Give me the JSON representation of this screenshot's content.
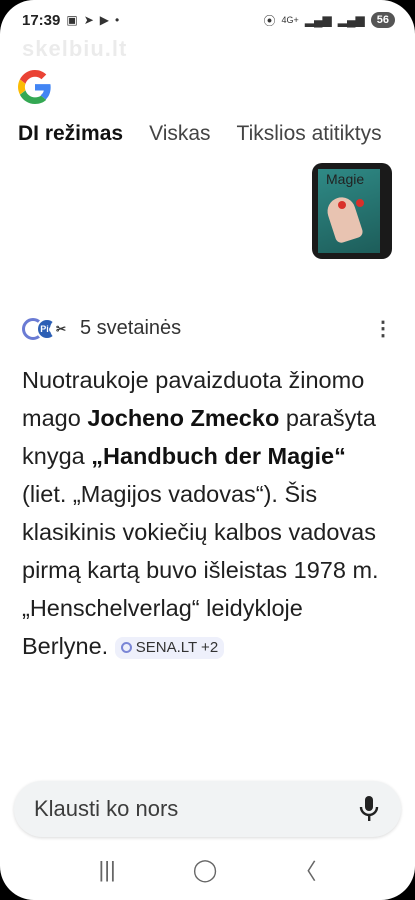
{
  "status_bar": {
    "time": "17:39",
    "battery": "56",
    "network": "4G+"
  },
  "watermark": "skelbiu.lt",
  "tabs": [
    {
      "label": "DI režimas",
      "active": true
    },
    {
      "label": "Viskas",
      "active": false
    },
    {
      "label": "Tikslios atitiktys",
      "active": false
    }
  ],
  "thumbnail": {
    "cover_title": "Magie"
  },
  "sources": {
    "label": "5 svetainės",
    "fav2": "Pic"
  },
  "answer": {
    "p1": "Nuotraukoje pavaizduota žinomo mago ",
    "b1": "Jocheno Zmecko",
    "p2": " parašyta knyga ",
    "b2": "„Handbuch der Magie“",
    "p3": " (liet. „Magijos vadovas“). Šis klasikinis vokiečių kalbos vadovas pirmą kartą buvo išleistas 1978 m. „Henschelverlag“ leidykloje Berlyne. ",
    "chip": "SENA.LT +2"
  },
  "ask_bar": {
    "placeholder": "Klausti ko nors"
  },
  "colors": {
    "accent": "#6a7bd4",
    "chip_bg": "#eef0fb"
  }
}
